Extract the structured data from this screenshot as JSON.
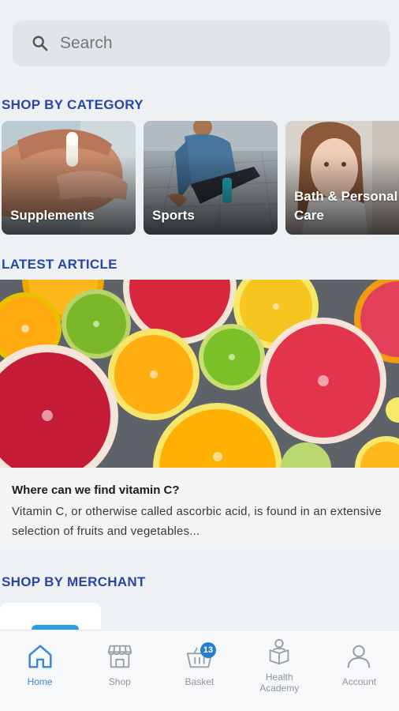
{
  "search": {
    "placeholder": "Search"
  },
  "sections": {
    "category_title": "SHOP BY CATEGORY",
    "article_title": "LATEST ARTICLE",
    "merchant_title": "SHOP BY MERCHANT"
  },
  "categories": [
    {
      "label": "Supplements"
    },
    {
      "label": "Sports"
    },
    {
      "label": "Bath & Personal\nCare"
    }
  ],
  "article": {
    "title": "Where can we find vitamin C?",
    "excerpt": "Vitamin C, or otherwise called ascorbic acid, is found in an extensive selection of fruits and  vegetables..."
  },
  "nav": {
    "items": [
      {
        "label": "Home",
        "icon": "home-icon",
        "active": true
      },
      {
        "label": "Shop",
        "icon": "shop-icon",
        "active": false
      },
      {
        "label": "Basket",
        "icon": "basket-icon",
        "active": false,
        "badge": "13"
      },
      {
        "label": "Health\nAcademy",
        "icon": "health-academy-icon",
        "active": false
      },
      {
        "label": "Account",
        "icon": "account-icon",
        "active": false
      }
    ]
  },
  "colors": {
    "accent": "#2746a8",
    "active_nav": "#3a86d8",
    "badge": "#2a7ed2",
    "background": "#eef1f4"
  }
}
